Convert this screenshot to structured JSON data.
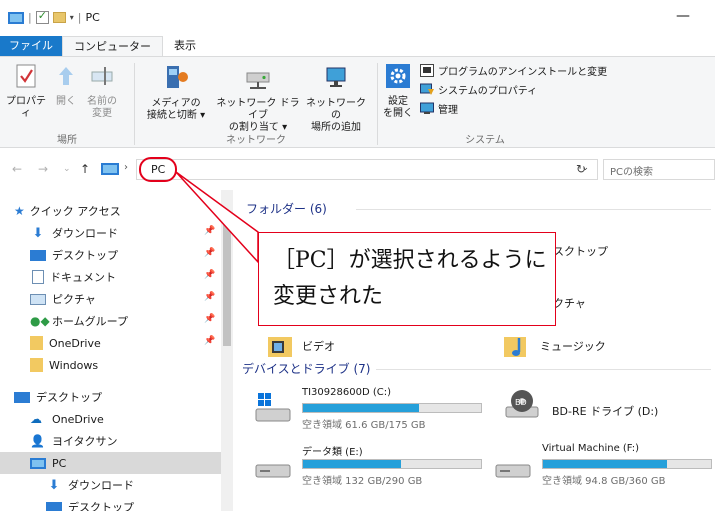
{
  "titlebar": {
    "title": "PC"
  },
  "tabs": [
    {
      "label": "ファイル"
    },
    {
      "label": "コンピューター"
    },
    {
      "label": "表示"
    }
  ],
  "ribbon": {
    "location_group": "場所",
    "network_group": "ネットワーク",
    "system_group": "システム",
    "properties": "プロパティ",
    "open": "開く",
    "rename_1": "名前の",
    "rename_2": "変更",
    "media_1": "メディアの",
    "media_2": "接続と切断 ▾",
    "netdrive_1": "ネットワーク ドライブ",
    "netdrive_2": "の割り当て ▾",
    "netloc_1": "ネットワークの",
    "netloc_2": "場所の追加",
    "settings_1": "設定",
    "settings_2": "を開く",
    "uninstall": "プログラムのアンインストールと変更",
    "sysprops": "システムのプロパティ",
    "manage": "管理"
  },
  "address": {
    "path": "PC",
    "search_placeholder": "PCの検索"
  },
  "nav": {
    "quick_access": "クイック アクセス",
    "items": [
      {
        "label": "ダウンロード"
      },
      {
        "label": "デスクトップ"
      },
      {
        "label": "ドキュメント"
      },
      {
        "label": "ピクチャ"
      },
      {
        "label": "ホームグループ"
      },
      {
        "label": "OneDrive"
      },
      {
        "label": "Windows"
      },
      {
        "label": "デスクトップ"
      },
      {
        "label": "OneDrive"
      },
      {
        "label": "ヨイタクサン"
      },
      {
        "label": "PC"
      },
      {
        "label": "ダウンロード"
      },
      {
        "label": "デスクトップ"
      }
    ]
  },
  "content": {
    "folders_header": "フォルダー (6)",
    "folders": [
      {
        "label": "デスクトップ"
      },
      {
        "label": "ピクチャ"
      },
      {
        "label": "ビデオ"
      },
      {
        "label": "ミュージック"
      }
    ],
    "drives_header": "デバイスとドライブ (7)",
    "drives": [
      {
        "name": "TI30928600D (C:)",
        "free": "空き領域 61.6 GB/175 GB",
        "used_fraction": 0.65
      },
      {
        "name": "BD-RE ドライブ (D:)",
        "free": "",
        "used_fraction": 0
      },
      {
        "name": "データ類 (E:)",
        "free": "空き領域 132 GB/290 GB",
        "used_fraction": 0.55
      },
      {
        "name": "Virtual Machine (F:)",
        "free": "空き領域 94.8 GB/360 GB",
        "used_fraction": 0.74
      }
    ]
  },
  "annotation": {
    "text": "［PC］が選択されるように変更された"
  },
  "colors": {
    "accent": "#1979ca",
    "annotation": "#e3001b",
    "drive_bar": "#26a0da"
  }
}
